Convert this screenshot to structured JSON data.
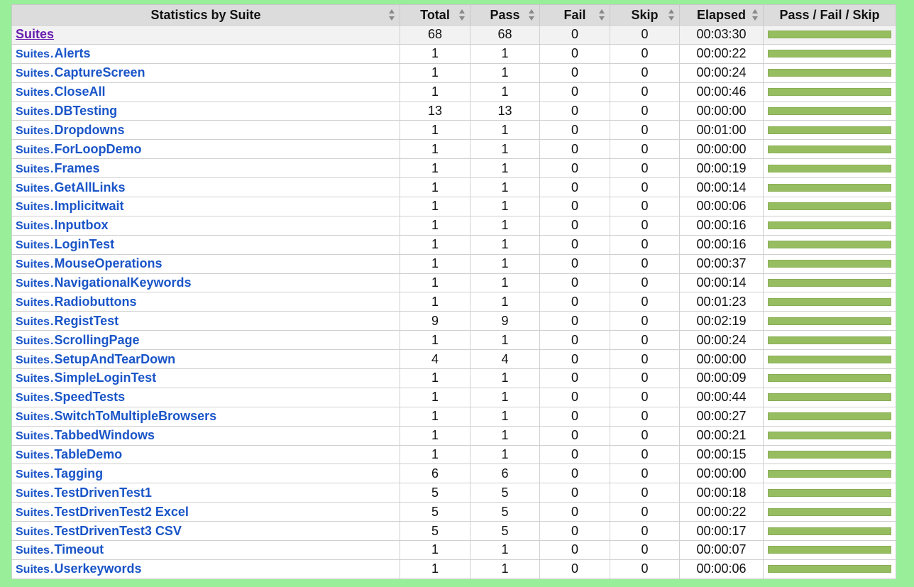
{
  "headers": {
    "name": "Statistics by Suite",
    "total": "Total",
    "pass": "Pass",
    "fail": "Fail",
    "skip": "Skip",
    "elapsed": "Elapsed",
    "graph": "Pass / Fail / Skip"
  },
  "total_row": {
    "name": "Suites",
    "total": "68",
    "pass": "68",
    "fail": "0",
    "skip": "0",
    "elapsed": "00:03:30",
    "pass_fraction": 1.0
  },
  "rows": [
    {
      "parent": "Suites",
      "name": "Alerts",
      "total": "1",
      "pass": "1",
      "fail": "0",
      "skip": "0",
      "elapsed": "00:00:22",
      "pass_fraction": 1.0
    },
    {
      "parent": "Suites",
      "name": "CaptureScreen",
      "total": "1",
      "pass": "1",
      "fail": "0",
      "skip": "0",
      "elapsed": "00:00:24",
      "pass_fraction": 1.0
    },
    {
      "parent": "Suites",
      "name": "CloseAll",
      "total": "1",
      "pass": "1",
      "fail": "0",
      "skip": "0",
      "elapsed": "00:00:46",
      "pass_fraction": 1.0
    },
    {
      "parent": "Suites",
      "name": "DBTesting",
      "total": "13",
      "pass": "13",
      "fail": "0",
      "skip": "0",
      "elapsed": "00:00:00",
      "pass_fraction": 1.0
    },
    {
      "parent": "Suites",
      "name": "Dropdowns",
      "total": "1",
      "pass": "1",
      "fail": "0",
      "skip": "0",
      "elapsed": "00:01:00",
      "pass_fraction": 1.0
    },
    {
      "parent": "Suites",
      "name": "ForLoopDemo",
      "total": "1",
      "pass": "1",
      "fail": "0",
      "skip": "0",
      "elapsed": "00:00:00",
      "pass_fraction": 1.0
    },
    {
      "parent": "Suites",
      "name": "Frames",
      "total": "1",
      "pass": "1",
      "fail": "0",
      "skip": "0",
      "elapsed": "00:00:19",
      "pass_fraction": 1.0
    },
    {
      "parent": "Suites",
      "name": "GetAllLinks",
      "total": "1",
      "pass": "1",
      "fail": "0",
      "skip": "0",
      "elapsed": "00:00:14",
      "pass_fraction": 1.0
    },
    {
      "parent": "Suites",
      "name": "Implicitwait",
      "total": "1",
      "pass": "1",
      "fail": "0",
      "skip": "0",
      "elapsed": "00:00:06",
      "pass_fraction": 1.0
    },
    {
      "parent": "Suites",
      "name": "Inputbox",
      "total": "1",
      "pass": "1",
      "fail": "0",
      "skip": "0",
      "elapsed": "00:00:16",
      "pass_fraction": 1.0
    },
    {
      "parent": "Suites",
      "name": "LoginTest",
      "total": "1",
      "pass": "1",
      "fail": "0",
      "skip": "0",
      "elapsed": "00:00:16",
      "pass_fraction": 1.0
    },
    {
      "parent": "Suites",
      "name": "MouseOperations",
      "total": "1",
      "pass": "1",
      "fail": "0",
      "skip": "0",
      "elapsed": "00:00:37",
      "pass_fraction": 1.0
    },
    {
      "parent": "Suites",
      "name": "NavigationalKeywords",
      "total": "1",
      "pass": "1",
      "fail": "0",
      "skip": "0",
      "elapsed": "00:00:14",
      "pass_fraction": 1.0
    },
    {
      "parent": "Suites",
      "name": "Radiobuttons",
      "total": "1",
      "pass": "1",
      "fail": "0",
      "skip": "0",
      "elapsed": "00:01:23",
      "pass_fraction": 1.0
    },
    {
      "parent": "Suites",
      "name": "RegistTest",
      "total": "9",
      "pass": "9",
      "fail": "0",
      "skip": "0",
      "elapsed": "00:02:19",
      "pass_fraction": 1.0
    },
    {
      "parent": "Suites",
      "name": "ScrollingPage",
      "total": "1",
      "pass": "1",
      "fail": "0",
      "skip": "0",
      "elapsed": "00:00:24",
      "pass_fraction": 1.0
    },
    {
      "parent": "Suites",
      "name": "SetupAndTearDown",
      "total": "4",
      "pass": "4",
      "fail": "0",
      "skip": "0",
      "elapsed": "00:00:00",
      "pass_fraction": 1.0
    },
    {
      "parent": "Suites",
      "name": "SimpleLoginTest",
      "total": "1",
      "pass": "1",
      "fail": "0",
      "skip": "0",
      "elapsed": "00:00:09",
      "pass_fraction": 1.0
    },
    {
      "parent": "Suites",
      "name": "SpeedTests",
      "total": "1",
      "pass": "1",
      "fail": "0",
      "skip": "0",
      "elapsed": "00:00:44",
      "pass_fraction": 1.0
    },
    {
      "parent": "Suites",
      "name": "SwitchToMultipleBrowsers",
      "total": "1",
      "pass": "1",
      "fail": "0",
      "skip": "0",
      "elapsed": "00:00:27",
      "pass_fraction": 1.0
    },
    {
      "parent": "Suites",
      "name": "TabbedWindows",
      "total": "1",
      "pass": "1",
      "fail": "0",
      "skip": "0",
      "elapsed": "00:00:21",
      "pass_fraction": 1.0
    },
    {
      "parent": "Suites",
      "name": "TableDemo",
      "total": "1",
      "pass": "1",
      "fail": "0",
      "skip": "0",
      "elapsed": "00:00:15",
      "pass_fraction": 1.0
    },
    {
      "parent": "Suites",
      "name": "Tagging",
      "total": "6",
      "pass": "6",
      "fail": "0",
      "skip": "0",
      "elapsed": "00:00:00",
      "pass_fraction": 1.0
    },
    {
      "parent": "Suites",
      "name": "TestDrivenTest1",
      "total": "5",
      "pass": "5",
      "fail": "0",
      "skip": "0",
      "elapsed": "00:00:18",
      "pass_fraction": 1.0
    },
    {
      "parent": "Suites",
      "name": "TestDrivenTest2 Excel",
      "total": "5",
      "pass": "5",
      "fail": "0",
      "skip": "0",
      "elapsed": "00:00:22",
      "pass_fraction": 1.0
    },
    {
      "parent": "Suites",
      "name": "TestDrivenTest3 CSV",
      "total": "5",
      "pass": "5",
      "fail": "0",
      "skip": "0",
      "elapsed": "00:00:17",
      "pass_fraction": 1.0
    },
    {
      "parent": "Suites",
      "name": "Timeout",
      "total": "1",
      "pass": "1",
      "fail": "0",
      "skip": "0",
      "elapsed": "00:00:07",
      "pass_fraction": 1.0
    },
    {
      "parent": "Suites",
      "name": "Userkeywords",
      "total": "1",
      "pass": "1",
      "fail": "0",
      "skip": "0",
      "elapsed": "00:00:06",
      "pass_fraction": 1.0
    }
  ],
  "colors": {
    "page_background": "#99ee99",
    "header_background": "#dcdcdc",
    "link": "#1a55c8",
    "visited_link": "#6a1fb0",
    "pass_bar": "#97bd61",
    "fail_bar": "#ce3e01",
    "skip_bar": "#fed84f"
  },
  "icons": {
    "sort": "sort-up-down-icon"
  }
}
